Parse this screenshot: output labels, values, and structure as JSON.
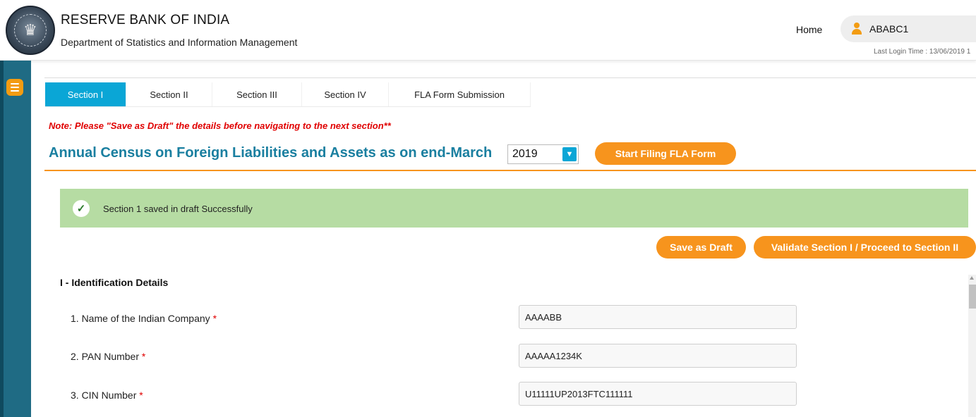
{
  "header": {
    "org_title": "RESERVE BANK OF INDIA",
    "org_subtitle": "Department of Statistics and Information Management",
    "home_label": "Home",
    "user_name": "ABABC1",
    "last_login": "Last Login Time : 13/06/2019 1"
  },
  "tabs": [
    {
      "label": "Section I",
      "active": true
    },
    {
      "label": "Section II",
      "active": false
    },
    {
      "label": "Section III",
      "active": false
    },
    {
      "label": "Section IV",
      "active": false
    },
    {
      "label": "FLA Form Submission",
      "active": false
    }
  ],
  "note": "Note: Please \"Save as Draft\" the details before navigating to the next section**",
  "census": {
    "title": "Annual Census on Foreign Liabilities and Assets as on end-March",
    "year": "2019",
    "start_label": "Start Filing FLA Form"
  },
  "alert": {
    "message": "Section 1 saved in draft Successfully"
  },
  "actions": {
    "save_draft": "Save as Draft",
    "validate": "Validate Section I / Proceed to Section II"
  },
  "form": {
    "section_heading": "I - Identification Details",
    "required_mark": "*",
    "fields": [
      {
        "label": "1. Name of the Indian Company",
        "value": "AAAABB"
      },
      {
        "label": "2. PAN Number",
        "value": "AAAAA1234K"
      },
      {
        "label": "3. CIN Number",
        "value": "U11111UP2013FTC111111"
      }
    ]
  },
  "colors": {
    "accent_blue": "#0aa6d6",
    "title_blue": "#1a7fa0",
    "orange": "#f7941d",
    "rail": "#1f6b84",
    "success_bg": "#b6dca3",
    "note_red": "#e00000"
  },
  "icons": {
    "logo": "rbi-emblem-icon",
    "user": "user-icon",
    "menu": "menu-icon",
    "check": "check-icon",
    "dropdown": "chevron-down-icon"
  }
}
